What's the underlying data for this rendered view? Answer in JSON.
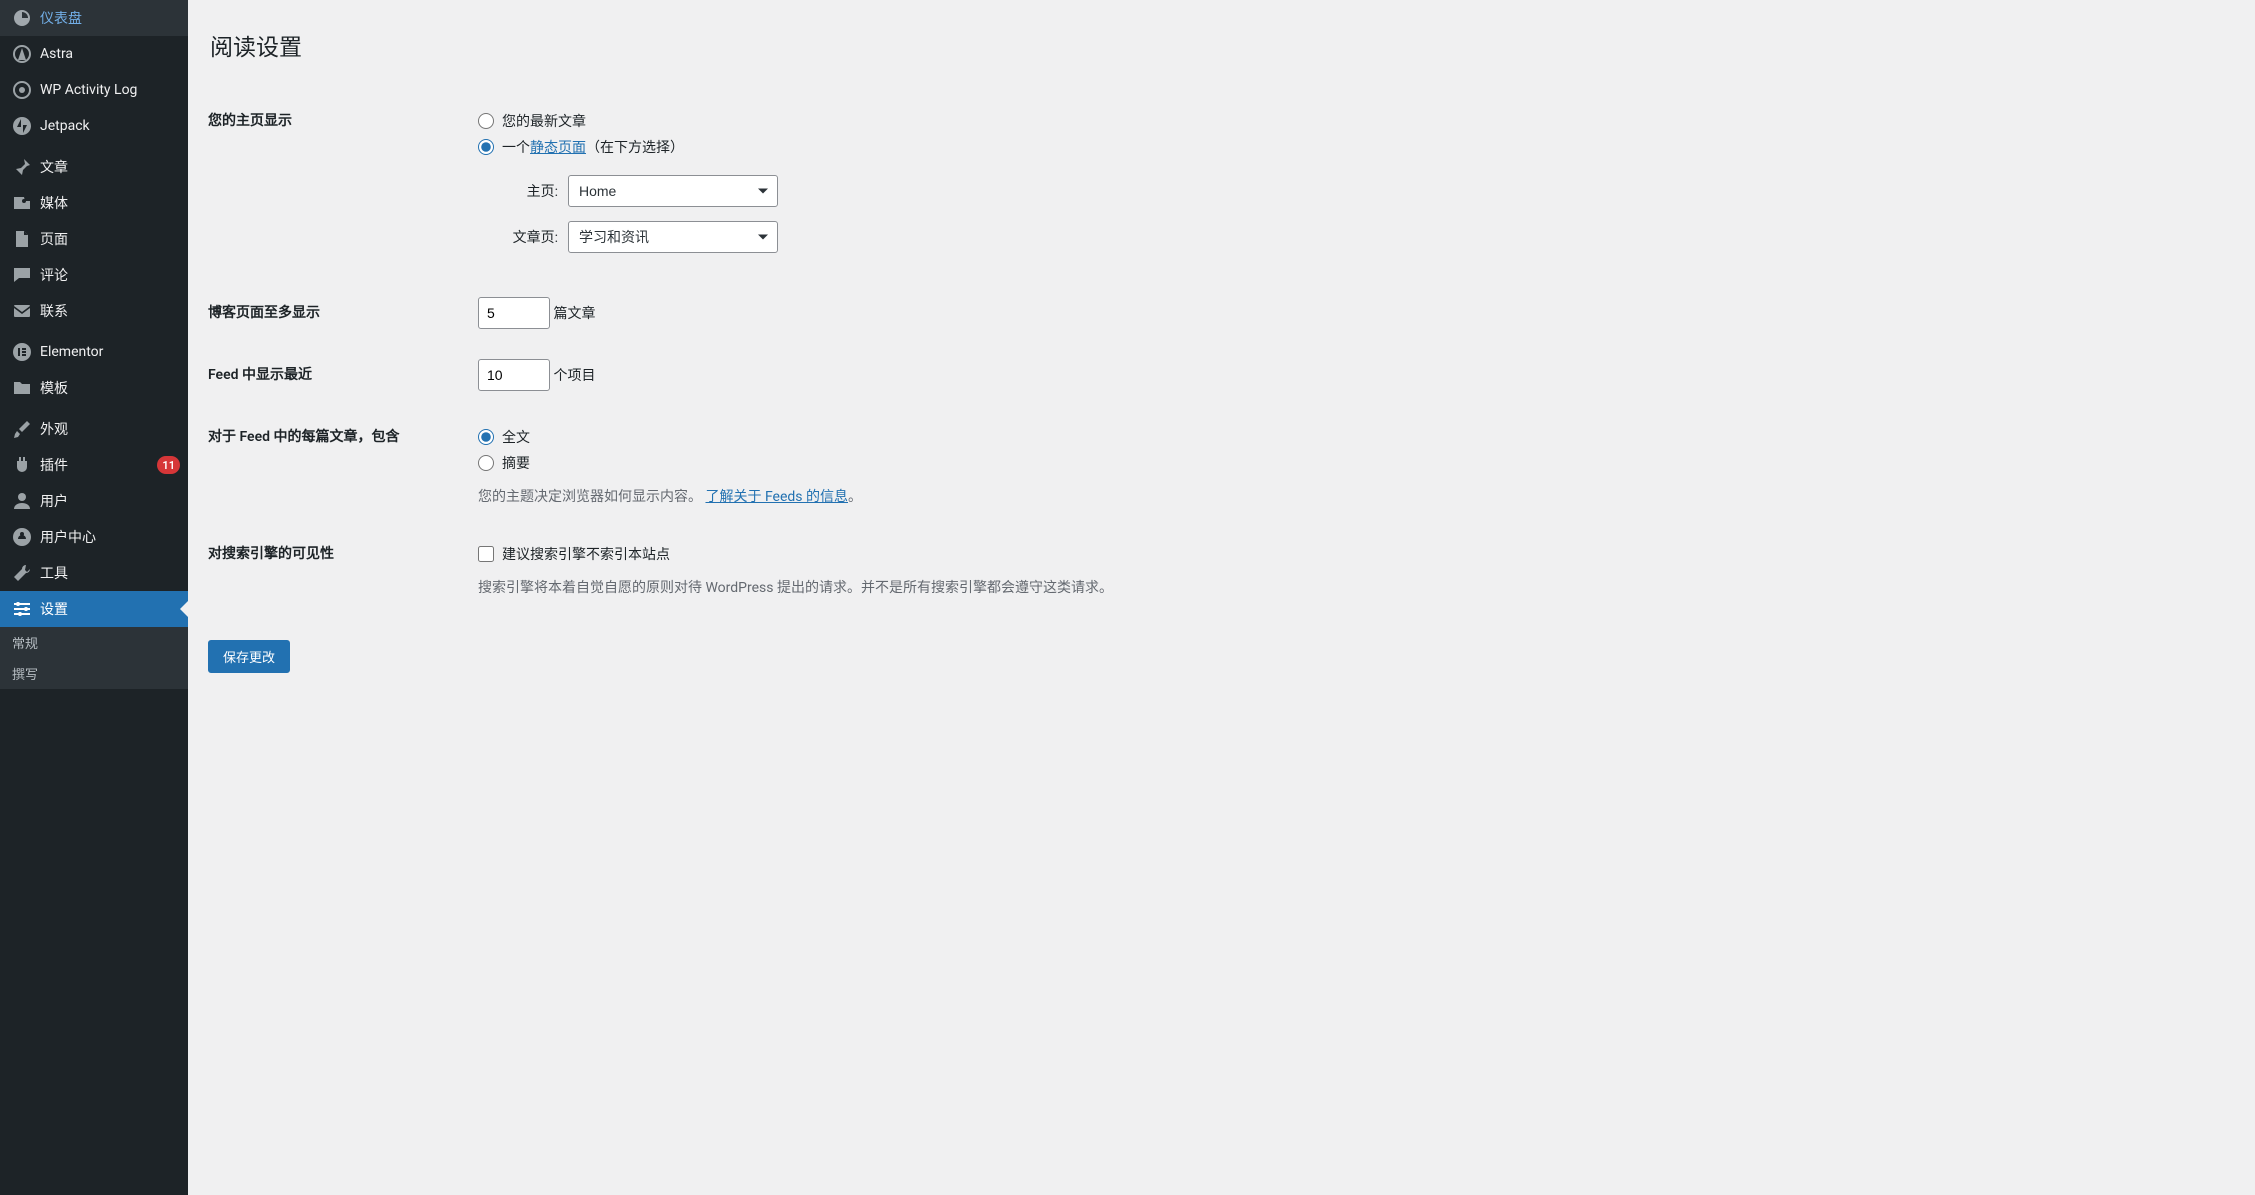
{
  "sidebar": {
    "items": [
      {
        "icon": "dashboard",
        "label": "仪表盘"
      },
      {
        "icon": "astra",
        "label": "Astra"
      },
      {
        "icon": "activity",
        "label": "WP Activity Log"
      },
      {
        "icon": "jetpack",
        "label": "Jetpack"
      }
    ],
    "items2": [
      {
        "icon": "pin",
        "label": "文章"
      },
      {
        "icon": "media",
        "label": "媒体"
      },
      {
        "icon": "page",
        "label": "页面"
      },
      {
        "icon": "comment",
        "label": "评论"
      },
      {
        "icon": "contact",
        "label": "联系"
      }
    ],
    "items3": [
      {
        "icon": "elementor",
        "label": "Elementor"
      },
      {
        "icon": "templates",
        "label": "模板"
      }
    ],
    "items4": [
      {
        "icon": "appearance",
        "label": "外观"
      },
      {
        "icon": "plugins",
        "label": "插件",
        "badge": "11"
      },
      {
        "icon": "users",
        "label": "用户"
      },
      {
        "icon": "usercenter",
        "label": "用户中心"
      },
      {
        "icon": "tools",
        "label": "工具"
      },
      {
        "icon": "settings",
        "label": "设置",
        "active": true
      }
    ],
    "sub": [
      "常规",
      "撰写"
    ]
  },
  "main": {
    "title": "阅读设置",
    "rows": {
      "homepage": {
        "label": "您的主页显示",
        "opt1": "您的最新文章",
        "opt2_prefix": "一个",
        "opt2_link": "静态页面",
        "opt2_suffix": "（在下方选择）",
        "home_label": "主页:",
        "home_value": "Home",
        "posts_label": "文章页:",
        "posts_value": "学习和资讯"
      },
      "blog_count": {
        "label": "博客页面至多显示",
        "value": "5",
        "suffix": "篇文章"
      },
      "feed_count": {
        "label": "Feed 中显示最近",
        "value": "10",
        "suffix": "个项目"
      },
      "feed_content": {
        "label": "对于 Feed 中的每篇文章，包含",
        "opt1": "全文",
        "opt2": "摘要",
        "desc_prefix": "您的主题决定浏览器如何显示内容。",
        "desc_link": "了解关于 Feeds 的信息",
        "desc_suffix": "。"
      },
      "search": {
        "label": "对搜索引擎的可见性",
        "check": "建议搜索引擎不索引本站点",
        "desc": "搜索引擎将本着自觉自愿的原则对待 WordPress 提出的请求。并不是所有搜索引擎都会遵守这类请求。"
      }
    },
    "submit": "保存更改"
  }
}
